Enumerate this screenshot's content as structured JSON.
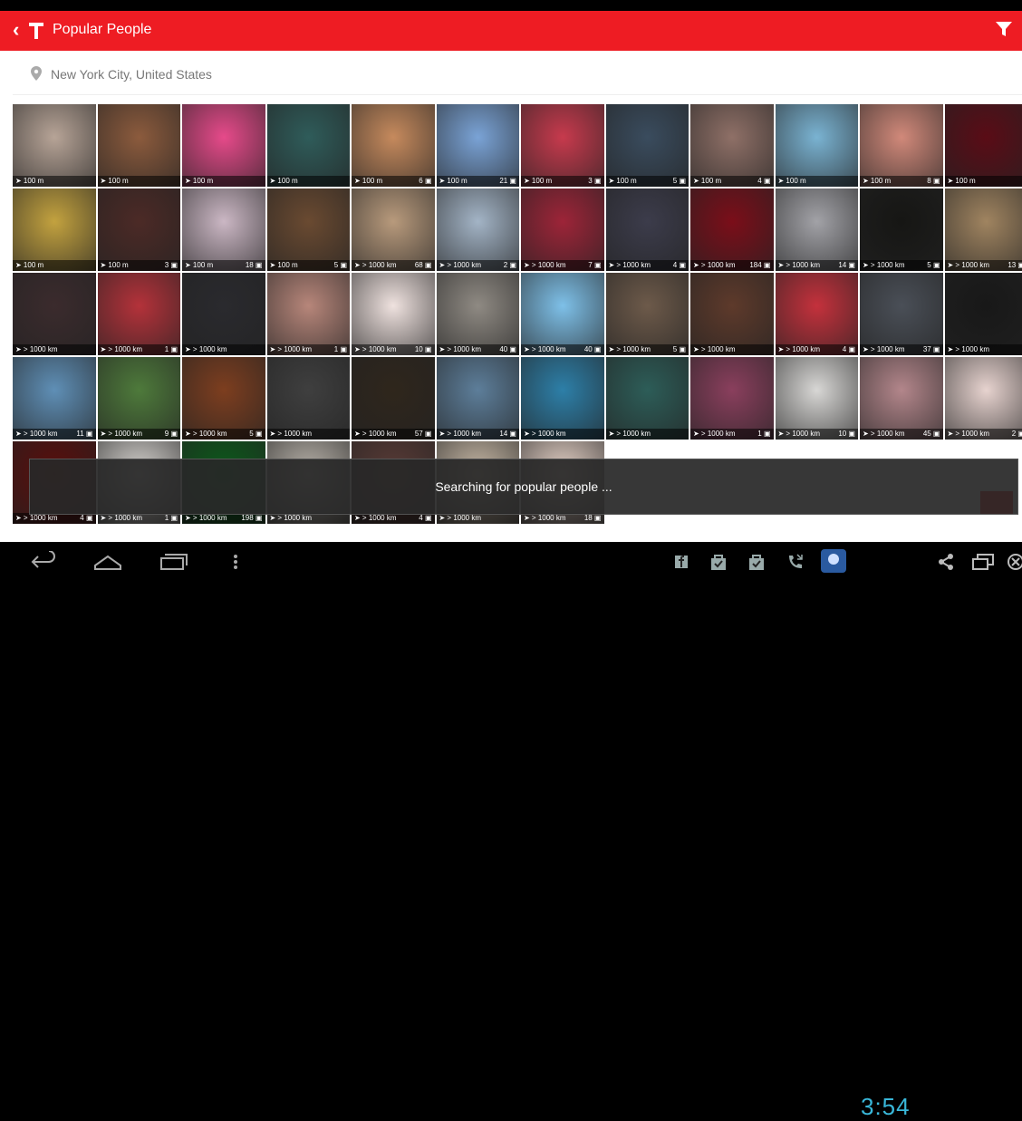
{
  "app": {
    "title": "Popular People",
    "location": "New York City, United States",
    "toast": "Searching for popular people ...",
    "colors": {
      "accent": "#ee1c23"
    }
  },
  "tiles": [
    {
      "dist": "100 m",
      "count": "",
      "color": "#b7a497"
    },
    {
      "dist": "100 m",
      "count": "",
      "color": "#8c5b3d"
    },
    {
      "dist": "100 m",
      "count": "",
      "color": "#e64a8a"
    },
    {
      "dist": "100 m",
      "count": "",
      "color": "#2f5c5a"
    },
    {
      "dist": "100 m",
      "count": "6",
      "color": "#c68a5d"
    },
    {
      "dist": "100 m",
      "count": "21",
      "color": "#7aa3d6"
    },
    {
      "dist": "100 m",
      "count": "3",
      "color": "#c73a4d"
    },
    {
      "dist": "100 m",
      "count": "5",
      "color": "#3a4c5e"
    },
    {
      "dist": "100 m",
      "count": "4",
      "color": "#8f7067"
    },
    {
      "dist": "100 m",
      "count": "",
      "color": "#7ab3d2"
    },
    {
      "dist": "100 m",
      "count": "8",
      "color": "#d1897a"
    },
    {
      "dist": "100 m",
      "count": "",
      "color": "#5a0c16"
    },
    {
      "dist": "100 m",
      "count": "",
      "color": "#c3a23f"
    },
    {
      "dist": "100 m",
      "count": "3",
      "color": "#4c2a26"
    },
    {
      "dist": "100 m",
      "count": "18",
      "color": "#cbb7c4"
    },
    {
      "dist": "100 m",
      "count": "5",
      "color": "#6a4a31"
    },
    {
      "dist": "> 1000 km",
      "count": "68",
      "color": "#b89a7c"
    },
    {
      "dist": "> 1000 km",
      "count": "2",
      "color": "#a3b4c6"
    },
    {
      "dist": "> 1000 km",
      "count": "7",
      "color": "#9d2438"
    },
    {
      "dist": "> 1000 km",
      "count": "4",
      "color": "#3c3c4b"
    },
    {
      "dist": "> 1000 km",
      "count": "184",
      "color": "#7b0e19"
    },
    {
      "dist": "> 1000 km",
      "count": "14",
      "color": "#a2a2a7"
    },
    {
      "dist": "> 1000 km",
      "count": "5",
      "color": "#161614"
    },
    {
      "dist": "> 1000 km",
      "count": "13",
      "color": "#a08460"
    },
    {
      "dist": "> 1000 km",
      "count": "",
      "color": "#3b2b2d"
    },
    {
      "dist": "> 1000 km",
      "count": "1",
      "color": "#b4323a"
    },
    {
      "dist": "> 1000 km",
      "count": "",
      "color": "#2a2a2e"
    },
    {
      "dist": "> 1000 km",
      "count": "1",
      "color": "#b7867a"
    },
    {
      "dist": "> 1000 km",
      "count": "10",
      "color": "#efe2df"
    },
    {
      "dist": "> 1000 km",
      "count": "40",
      "color": "#8f8a83"
    },
    {
      "dist": "> 1000 km",
      "count": "40",
      "color": "#7ec0e8"
    },
    {
      "dist": "> 1000 km",
      "count": "5",
      "color": "#6d5a4a"
    },
    {
      "dist": "> 1000 km",
      "count": "",
      "color": "#5e3a2b"
    },
    {
      "dist": "> 1000 km",
      "count": "4",
      "color": "#c4313c"
    },
    {
      "dist": "> 1000 km",
      "count": "37",
      "color": "#4a4f57"
    },
    {
      "dist": "> 1000 km",
      "count": "",
      "color": "#181818"
    },
    {
      "dist": "> 1000 km",
      "count": "11",
      "color": "#5f8fb6"
    },
    {
      "dist": "> 1000 km",
      "count": "9",
      "color": "#4e7a3b"
    },
    {
      "dist": "> 1000 km",
      "count": "5",
      "color": "#7d3e1f"
    },
    {
      "dist": "> 1000 km",
      "count": "",
      "color": "#3f3f3f"
    },
    {
      "dist": "> 1000 km",
      "count": "57",
      "color": "#2f261c"
    },
    {
      "dist": "> 1000 km",
      "count": "14",
      "color": "#5d7e9a"
    },
    {
      "dist": "> 1000 km",
      "count": "",
      "color": "#2d7fa8"
    },
    {
      "dist": "> 1000 km",
      "count": "",
      "color": "#2d5d58"
    },
    {
      "dist": "> 1000 km",
      "count": "1",
      "color": "#8a3f5d"
    },
    {
      "dist": "> 1000 km",
      "count": "10",
      "color": "#d8d7d5"
    },
    {
      "dist": "> 1000 km",
      "count": "45",
      "color": "#b3868b"
    },
    {
      "dist": "> 1000 km",
      "count": "2",
      "color": "#e7d3cf"
    },
    {
      "dist": "> 1000 km",
      "count": "4",
      "color": "#5b0d0b"
    },
    {
      "dist": "> 1000 km",
      "count": "1",
      "color": "#d6d3cf"
    },
    {
      "dist": "> 1000 km",
      "count": "198",
      "color": "#0b5b1a"
    },
    {
      "dist": "> 1000 km",
      "count": "",
      "color": "#b9b3aa"
    },
    {
      "dist": "> 1000 km",
      "count": "4",
      "color": "#5a3b36"
    },
    {
      "dist": "> 1000 km",
      "count": "",
      "color": "#c8b9a6"
    },
    {
      "dist": "> 1000 km",
      "count": "18",
      "color": "#e6d2c7"
    }
  ],
  "clock": "3:54",
  "nav": {
    "back": "back-icon",
    "home": "home-icon",
    "recents": "recents-icon",
    "menu": "menu-dots-icon"
  }
}
